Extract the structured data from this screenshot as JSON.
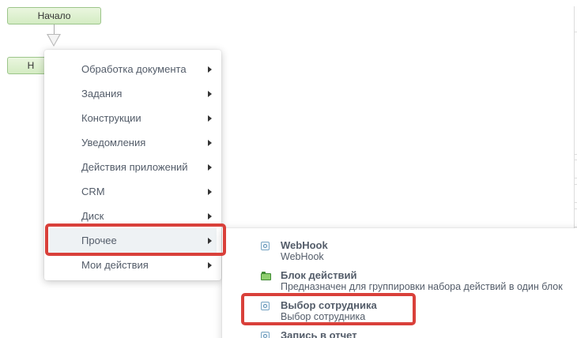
{
  "canvas": {
    "start_block_label": "Начало",
    "second_block_label": "Н"
  },
  "menu": {
    "items": [
      {
        "label": "Обработка документа",
        "has_submenu": true
      },
      {
        "label": "Задания",
        "has_submenu": true
      },
      {
        "label": "Конструкции",
        "has_submenu": true
      },
      {
        "label": "Уведомления",
        "has_submenu": true
      },
      {
        "label": "Действия приложений",
        "has_submenu": true
      },
      {
        "label": "CRM",
        "has_submenu": true
      },
      {
        "label": "Диск",
        "has_submenu": true
      },
      {
        "label": "Прочее",
        "has_submenu": true,
        "active": true
      },
      {
        "label": "Мои действия",
        "has_submenu": true
      }
    ]
  },
  "submenu": {
    "items": [
      {
        "title": "WebHook",
        "description": "WebHook",
        "icon": "activity-icon"
      },
      {
        "title": "Блок действий",
        "description": "Предназначен для группировки набора действий в один блок",
        "icon": "folder-icon"
      },
      {
        "title": "Выбор сотрудника",
        "description": "Выбор сотрудника",
        "icon": "activity-icon"
      },
      {
        "title": "Запись в отчет",
        "description": "",
        "icon": "activity-icon"
      }
    ]
  },
  "colors": {
    "highlight": "#d9403a",
    "block_fill": "#d4ecc3",
    "block_border": "#9cc58a",
    "menu_text": "#535c69",
    "active_row": "#eef2f4"
  }
}
